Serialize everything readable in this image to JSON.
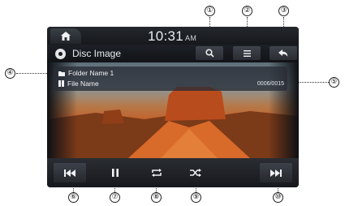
{
  "clock": {
    "time": "10:31",
    "ampm": "AM"
  },
  "title": "Disc Image",
  "info": {
    "folder_name": "Folder Name 1",
    "file_name": "File Name",
    "track_count": "0006/0015"
  },
  "callouts": [
    "①",
    "②",
    "③",
    "④",
    "⑤",
    "⑥",
    "⑦",
    "⑧",
    "⑨",
    "⑩"
  ],
  "icons": {
    "home": "home-icon",
    "disc": "disc-icon",
    "search": "search-icon",
    "menu": "menu-icon",
    "back": "back-icon",
    "folder": "folder-icon",
    "file": "file-icon",
    "prev": "previous-track-icon",
    "pause": "pause-icon",
    "repeat": "repeat-icon",
    "shuffle": "shuffle-icon",
    "next": "next-track-icon"
  }
}
